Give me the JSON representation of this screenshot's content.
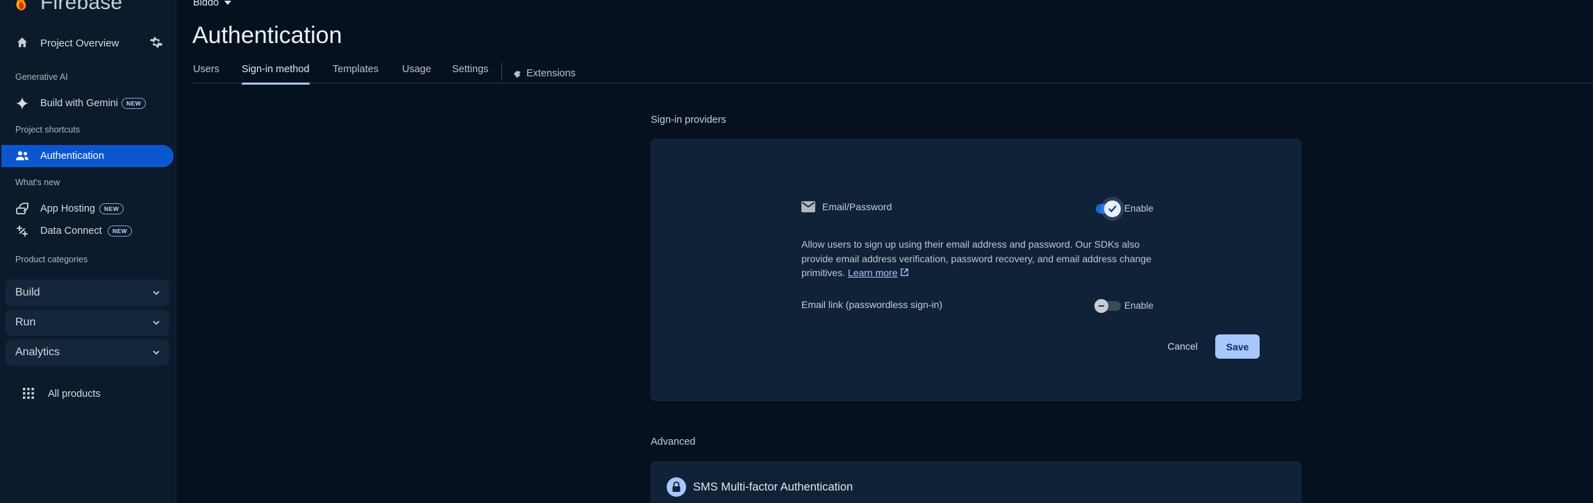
{
  "app": {
    "brand": "Firebase",
    "project": "Biddo"
  },
  "sidebar": {
    "project_overview": "Project Overview",
    "sections": {
      "generative_ai": "Generative AI",
      "project_shortcuts": "Project shortcuts",
      "whats_new": "What's new",
      "product_categories": "Product categories"
    },
    "items": {
      "build_with_gemini": {
        "label": "Build with Gemini",
        "badge": "NEW",
        "icon": "sparkle-icon"
      },
      "authentication": {
        "label": "Authentication",
        "icon": "people-icon"
      },
      "app_hosting": {
        "label": "App Hosting",
        "badge": "NEW",
        "icon": "hosting-icon"
      },
      "data_connect": {
        "label": "Data Connect",
        "badge": "NEW",
        "icon": "data-connect-icon"
      }
    },
    "categories": [
      "Build",
      "Run",
      "Analytics"
    ],
    "all_products": "All products"
  },
  "page": {
    "title": "Authentication",
    "tabs": [
      "Users",
      "Sign-in method",
      "Templates",
      "Usage",
      "Settings",
      "Extensions"
    ],
    "active_tab": "Sign-in method"
  },
  "providers": {
    "heading": "Sign-in providers",
    "email_password": {
      "label": "Email/Password",
      "enable_label": "Enable",
      "enabled": true
    },
    "description": "Allow users to sign up using their email address and password. Our SDKs also provide email address verification, password recovery, and email address change primitives.",
    "learn_more": "Learn more",
    "email_link": {
      "label": "Email link (passwordless sign-in)",
      "enable_label": "Enable",
      "enabled": false
    },
    "cancel": "Cancel",
    "save": "Save"
  },
  "advanced": {
    "heading": "Advanced",
    "sms_mfa": "SMS Multi-factor Authentication"
  },
  "colors": {
    "accent": "#a8c7fa",
    "active_nav": "#0b57d0",
    "toggle_on": "#1967d2",
    "background": "#06111f"
  }
}
